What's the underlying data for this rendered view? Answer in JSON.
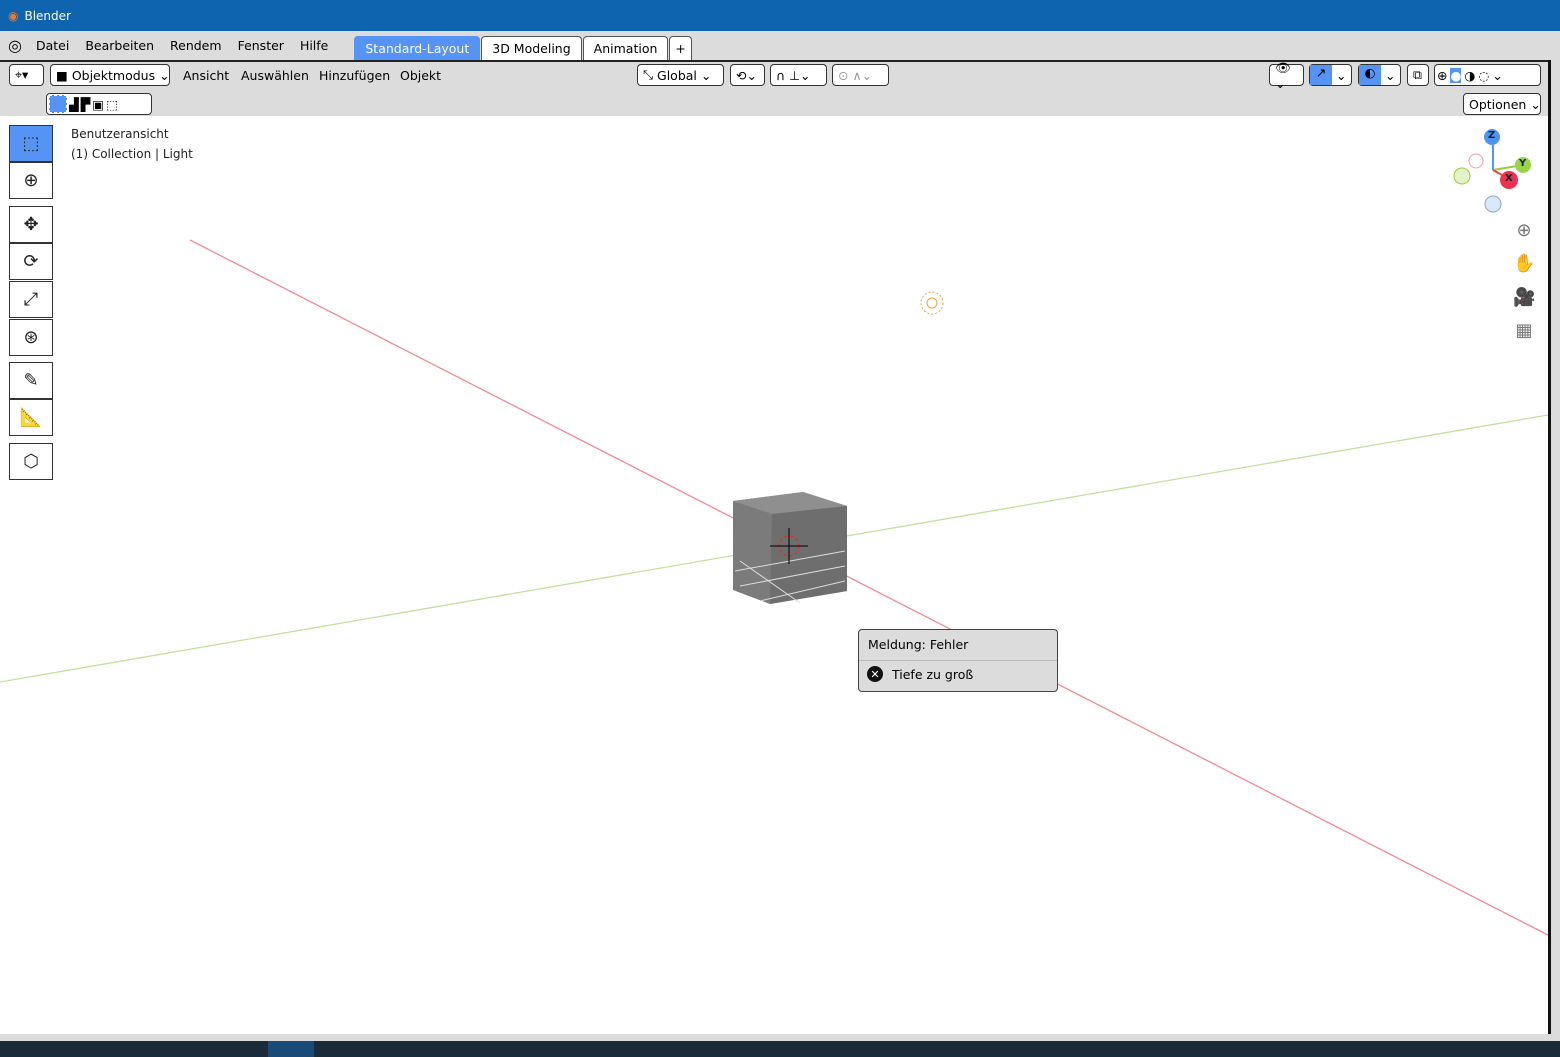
{
  "window": {
    "title": "Blender"
  },
  "menubar": {
    "items": [
      "Datei",
      "Bearbeiten",
      "Rendem",
      "Fenster",
      "Hilfe"
    ],
    "tabs": [
      "Standard-Layout",
      "3D Modeling",
      "Animation"
    ],
    "add_tab": "+"
  },
  "header": {
    "mode": "Objektmodus",
    "menus": [
      "Ansicht",
      "Auswählen",
      "Hinzufügen",
      "Objekt"
    ],
    "orientation": "Global",
    "options": "Optionen"
  },
  "viewport": {
    "view_name": "Benutzeransicht",
    "collection": "(1) Collection | Light"
  },
  "gizmo": {
    "z": "Z",
    "y": "Y",
    "x": "X"
  },
  "popup": {
    "title": "Meldung: Fehler",
    "message": "Tiefe zu groß"
  },
  "colors": {
    "accent": "#5593f4",
    "titlebar": "#0f64b0",
    "x_axis": "#f08c96",
    "y_axis": "#c4e09a"
  }
}
